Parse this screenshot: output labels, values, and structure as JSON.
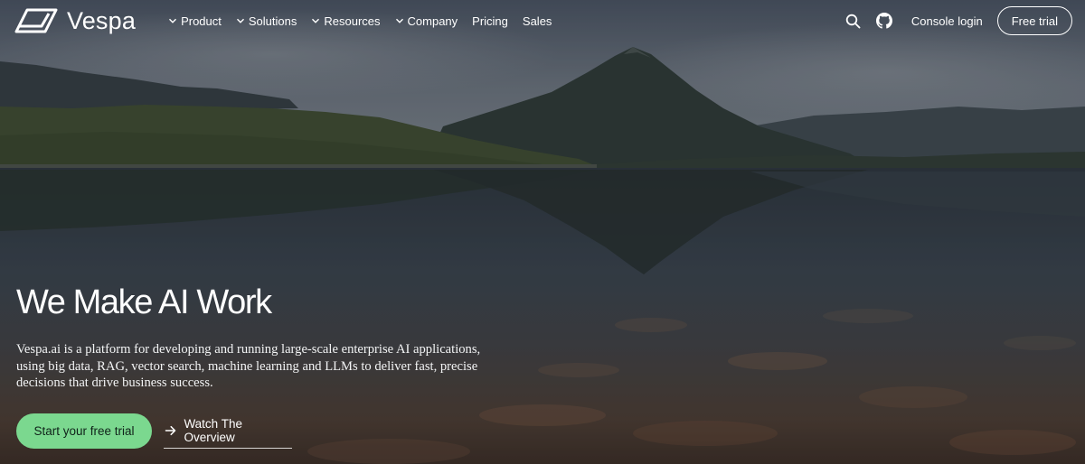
{
  "brand": {
    "name": "Vespa",
    "logo_icon": "vespa-logo-icon"
  },
  "nav": {
    "items": [
      {
        "label": "Product",
        "dropdown": true
      },
      {
        "label": "Solutions",
        "dropdown": true
      },
      {
        "label": "Resources",
        "dropdown": true
      },
      {
        "label": "Company",
        "dropdown": true
      },
      {
        "label": "Pricing",
        "dropdown": false
      },
      {
        "label": "Sales",
        "dropdown": false
      }
    ],
    "search_icon": "search-icon",
    "github_icon": "github-icon",
    "console_login": "Console login",
    "free_trial": "Free trial"
  },
  "hero": {
    "headline": "We Make AI Work",
    "description": "Vespa.ai is a platform for developing and running large-scale enterprise AI applications, using big data, RAG, vector search, machine learning and LLMs to deliver fast, precise decisions that drive business success.",
    "primary_cta": "Start your free trial",
    "secondary_cta": "Watch The Overview",
    "secondary_icon": "arrow-right-icon"
  },
  "colors": {
    "cta_green": "#7bd88f",
    "text": "#ffffff"
  }
}
